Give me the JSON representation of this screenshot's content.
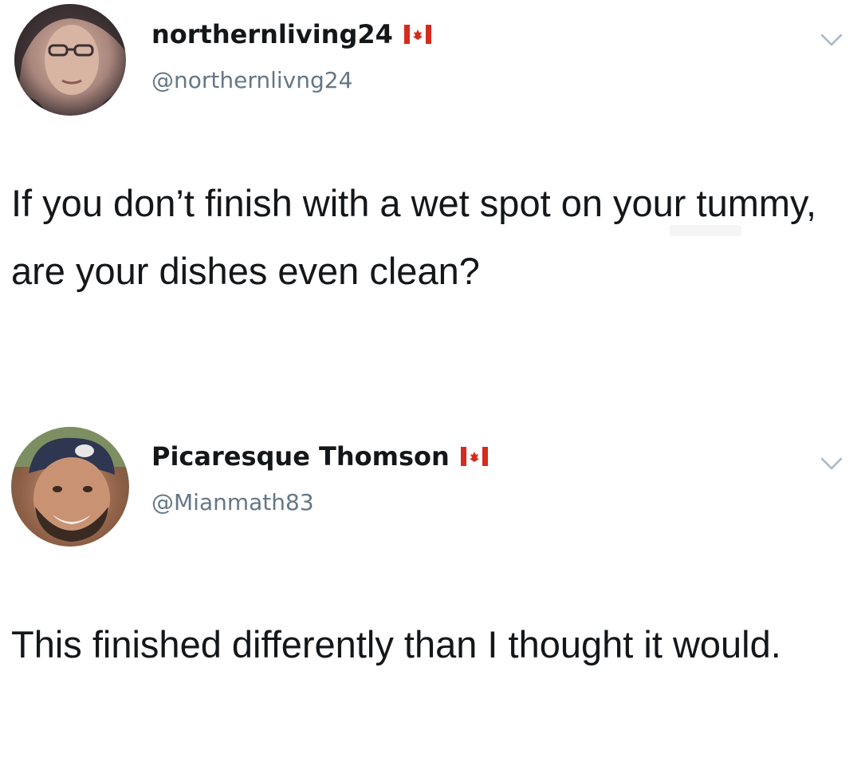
{
  "tweets": [
    {
      "display_name": "northernliving24",
      "handle": "@northernlivng24",
      "text": "If you don’t finish with a wet spot on your tummy, are your dishes even clean?",
      "avatar_icon": "user-avatar-woman",
      "flag_icon": "canada-flag-icon"
    },
    {
      "display_name": "Picaresque Thomson",
      "handle": "@Mianmath83",
      "text": "This finished differently than I thought it would.",
      "avatar_icon": "user-avatar-man-cap",
      "flag_icon": "canada-flag-icon"
    }
  ],
  "colors": {
    "text_primary": "#14171a",
    "text_secondary": "#657786",
    "flag_red": "#d52b1e",
    "chevron": "#aab8c2"
  }
}
